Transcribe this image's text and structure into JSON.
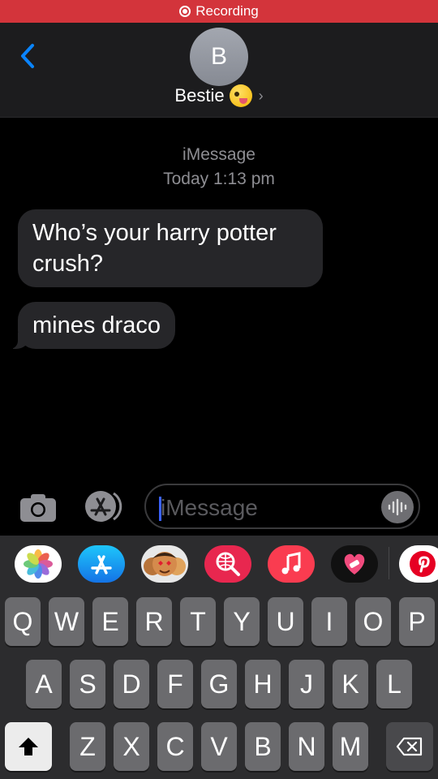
{
  "recording": {
    "label": "Recording"
  },
  "header": {
    "avatar_initial": "B",
    "contact_name": "Bestie",
    "chevron": "›"
  },
  "thread": {
    "service": "iMessage",
    "timestamp": "Today 1:13 pm"
  },
  "messages": [
    {
      "text": "Who’s your harry potter crush?",
      "direction": "received"
    },
    {
      "text": "mines draco",
      "direction": "received"
    }
  ],
  "composer": {
    "placeholder": "iMessage",
    "icons": [
      "camera-icon",
      "app-store-icon",
      "audio-waveform-icon"
    ]
  },
  "app_drawer": [
    "photos-app",
    "app-store-app",
    "memoji-app",
    "image-search-app",
    "music-app",
    "heart-stickers-app",
    "pinterest-app"
  ],
  "keyboard": {
    "row1": [
      "Q",
      "W",
      "E",
      "R",
      "T",
      "Y",
      "U",
      "I",
      "O",
      "P"
    ],
    "row2": [
      "A",
      "S",
      "D",
      "F",
      "G",
      "H",
      "J",
      "K",
      "L"
    ],
    "row3": [
      "Z",
      "X",
      "C",
      "V",
      "B",
      "N",
      "M"
    ]
  },
  "colors": {
    "accent": "#0a84ff",
    "recording": "#d3343b",
    "bubble": "#262629",
    "pinterest": "#e60023",
    "music": "#fa3c50"
  }
}
